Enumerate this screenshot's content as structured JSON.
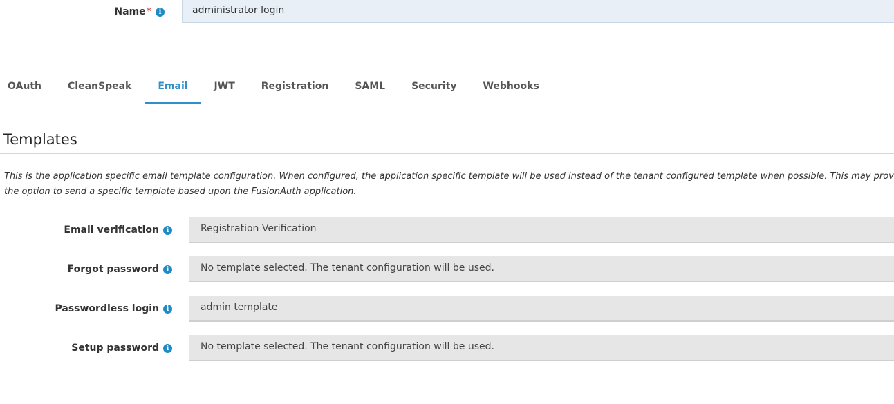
{
  "name_field": {
    "label": "Name",
    "required_mark": "*",
    "value": "administrator login"
  },
  "tabs": [
    {
      "label": "OAuth",
      "active": false
    },
    {
      "label": "CleanSpeak",
      "active": false
    },
    {
      "label": "Email",
      "active": true
    },
    {
      "label": "JWT",
      "active": false
    },
    {
      "label": "Registration",
      "active": false
    },
    {
      "label": "SAML",
      "active": false
    },
    {
      "label": "Security",
      "active": false
    },
    {
      "label": "Webhooks",
      "active": false
    }
  ],
  "templates": {
    "title": "Templates",
    "description_line1": "This is the application specific email template configuration. When configured, the application specific template will be used instead of the tenant configured template when possible. This may provi",
    "description_line2": "the option to send a specific template based upon the FusionAuth application.",
    "fields": [
      {
        "label": "Email verification",
        "value": "Registration Verification"
      },
      {
        "label": "Forgot password",
        "value": "No template selected. The tenant configuration will be used."
      },
      {
        "label": "Passwordless login",
        "value": "admin template"
      },
      {
        "label": "Setup password",
        "value": "No template selected. The tenant configuration will be used."
      }
    ]
  },
  "icons": {
    "info": "info-circle-icon"
  },
  "colors": {
    "accent": "#2e8fcb",
    "required": "#d9534f",
    "info_icon": "#1e8bc3"
  }
}
